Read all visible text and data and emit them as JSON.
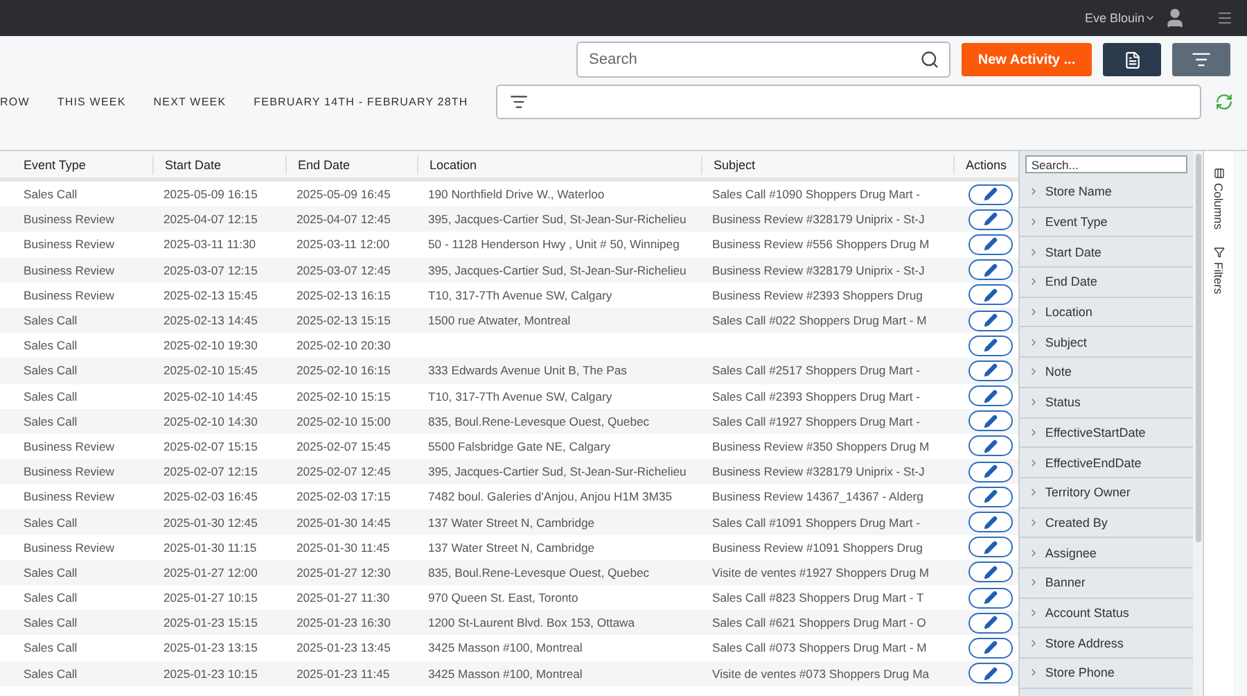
{
  "top_bar": {
    "user_name": "Eve Blouin"
  },
  "toolbar": {
    "search_placeholder": "Search",
    "new_button": "New Activity ..."
  },
  "quick_ranges": [
    "ROW",
    "THIS WEEK",
    "NEXT WEEK",
    "FEBRUARY 14TH - FEBRUARY 28TH"
  ],
  "grid": {
    "columns": [
      "Event Type",
      "Start Date",
      "End Date",
      "Location",
      "Subject",
      "Actions"
    ],
    "rows": [
      [
        "Sales Call",
        "2025-05-09 16:15",
        "2025-05-09 16:45",
        "190 Northfield Drive W., Waterloo",
        "Sales Call #1090 Shoppers Drug Mart -"
      ],
      [
        "Business Review",
        "2025-04-07 12:15",
        "2025-04-07 12:45",
        "395, Jacques-Cartier Sud, St-Jean-Sur-Richelieu",
        "Business Review #328179 Uniprix - St-J"
      ],
      [
        "Business Review",
        "2025-03-11 11:30",
        "2025-03-11 12:00",
        "50 - 1128 Henderson Hwy , Unit # 50, Winnipeg",
        "Business Review #556 Shoppers Drug M"
      ],
      [
        "Business Review",
        "2025-03-07 12:15",
        "2025-03-07 12:45",
        "395, Jacques-Cartier Sud, St-Jean-Sur-Richelieu",
        "Business Review #328179 Uniprix - St-J"
      ],
      [
        "Business Review",
        "2025-02-13 15:45",
        "2025-02-13 16:15",
        "T10, 317-7Th Avenue SW, Calgary",
        "Business Review #2393 Shoppers Drug"
      ],
      [
        "Sales Call",
        "2025-02-13 14:45",
        "2025-02-13 15:15",
        "1500 rue Atwater, Montreal",
        "Sales Call #022 Shoppers Drug Mart - M"
      ],
      [
        "Sales Call",
        "2025-02-10 19:30",
        "2025-02-10 20:30",
        "",
        ""
      ],
      [
        "Sales Call",
        "2025-02-10 15:45",
        "2025-02-10 16:15",
        "333 Edwards Avenue Unit B, The Pas",
        "Sales Call #2517 Shoppers Drug Mart -"
      ],
      [
        "Sales Call",
        "2025-02-10 14:45",
        "2025-02-10 15:15",
        "T10, 317-7Th Avenue SW, Calgary",
        "Sales Call #2393 Shoppers Drug Mart -"
      ],
      [
        "Sales Call",
        "2025-02-10 14:30",
        "2025-02-10 15:00",
        "835, Boul.Rene-Levesque Ouest, Quebec",
        "Sales Call #1927 Shoppers Drug Mart -"
      ],
      [
        "Business Review",
        "2025-02-07 15:15",
        "2025-02-07 15:45",
        "5500 Falsbridge Gate NE, Calgary",
        "Business Review #350 Shoppers Drug M"
      ],
      [
        "Business Review",
        "2025-02-07 12:15",
        "2025-02-07 12:45",
        "395, Jacques-Cartier Sud, St-Jean-Sur-Richelieu",
        "Business Review #328179 Uniprix - St-J"
      ],
      [
        "Business Review",
        "2025-02-03 16:45",
        "2025-02-03 17:15",
        "7482 boul. Galeries d'Anjou, Anjou H1M 3M35",
        "Business Review 14367_14367 - Alderg"
      ],
      [
        "Sales Call",
        "2025-01-30 12:45",
        "2025-01-30 14:45",
        "137 Water Street N, Cambridge",
        "Sales Call #1091 Shoppers Drug Mart -"
      ],
      [
        "Business Review",
        "2025-01-30 11:15",
        "2025-01-30 11:45",
        "137 Water Street N, Cambridge",
        "Business Review #1091 Shoppers Drug"
      ],
      [
        "Sales Call",
        "2025-01-27 12:00",
        "2025-01-27 12:30",
        "835, Boul.Rene-Levesque Ouest, Quebec",
        "Visite de ventes #1927 Shoppers Drug M"
      ],
      [
        "Sales Call",
        "2025-01-27 10:15",
        "2025-01-27 11:30",
        "970 Queen St. East, Toronto",
        "Sales Call #823 Shoppers Drug Mart - T"
      ],
      [
        "Sales Call",
        "2025-01-23 15:15",
        "2025-01-23 16:30",
        "1200 St-Laurent Blvd. Box 153, Ottawa",
        "Sales Call #621 Shoppers Drug Mart - O"
      ],
      [
        "Sales Call",
        "2025-01-23 13:15",
        "2025-01-23 13:45",
        "3425 Masson #100, Montreal",
        "Sales Call #073 Shoppers Drug Mart - M"
      ],
      [
        "Sales Call",
        "2025-01-23 10:15",
        "2025-01-23 11:45",
        "3425 Masson #100, Montreal",
        "Visite de ventes #073 Shoppers Drug Ma"
      ]
    ]
  },
  "column_panel": {
    "search_placeholder": "Search...",
    "items": [
      "Store Name",
      "Event Type",
      "Start Date",
      "End Date",
      "Location",
      "Subject",
      "Note",
      "Status",
      "EffectiveStartDate",
      "EffectiveEndDate",
      "Territory Owner",
      "Created By",
      "Assignee",
      "Banner",
      "Account Status",
      "Store Address",
      "Store Phone"
    ]
  },
  "side_tabs": [
    "Columns",
    "Filters"
  ]
}
